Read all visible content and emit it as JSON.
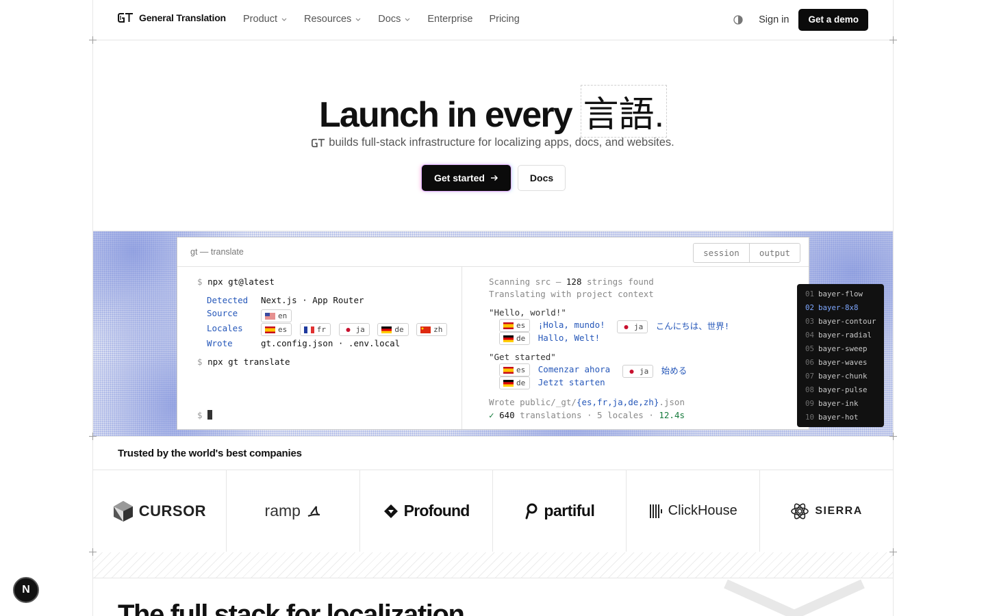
{
  "nav": {
    "brand": "General Translation",
    "links": [
      {
        "label": "Product"
      },
      {
        "label": "Resources"
      },
      {
        "label": "Docs"
      },
      {
        "label": "Enterprise"
      },
      {
        "label": "Pricing"
      }
    ],
    "sign_in": "Sign in",
    "demo": "Get a demo"
  },
  "hero": {
    "title_prefix": "Launch in every",
    "title_word": "言語",
    "title_suffix": ".",
    "subtitle": "builds full-stack infrastructure for localizing apps, docs, and websites.",
    "primary_cta": "Get started",
    "secondary_cta": "Docs"
  },
  "terminal": {
    "title": "gt — translate",
    "tabs": [
      "session",
      "output"
    ],
    "left": {
      "cmd1": "npx gt@latest",
      "detected_label": "Detected",
      "detected_value": "Next.js · App Router",
      "source_label": "Source",
      "source_locale": "en",
      "locales_label": "Locales",
      "locales": [
        "es",
        "fr",
        "ja",
        "de",
        "zh"
      ],
      "wrote_label": "Wrote",
      "wrote_value": "gt.config.json · .env.local",
      "cmd2": "npx gt translate",
      "prompt": "$"
    },
    "right": {
      "scan_prefix": "Scanning src —",
      "scan_count": "128",
      "scan_suffix": "strings found",
      "context": "Translating with project context",
      "block1_source": "\"Hello, world!\"",
      "block1": {
        "es": "¡Hola, mundo!",
        "ja": "こんにちは、世界!",
        "de": "Hallo, Welt!"
      },
      "block2_source": "\"Get started\"",
      "block2": {
        "es": "Comenzar ahora",
        "ja": "始める",
        "de": "Jetzt starten"
      },
      "wrote_prefix": "Wrote public/_gt/",
      "wrote_glob": "{es,fr,ja,de,zh}",
      "wrote_ext": ".json",
      "check": "✓",
      "translations_count": "640",
      "translations_label": "translations · 5 locales ·",
      "time": "12.4s"
    }
  },
  "presets": [
    {
      "num": "01",
      "name": "bayer-flow"
    },
    {
      "num": "02",
      "name": "bayer-8x8",
      "active": true
    },
    {
      "num": "03",
      "name": "bayer-contour"
    },
    {
      "num": "04",
      "name": "bayer-radial"
    },
    {
      "num": "05",
      "name": "bayer-sweep"
    },
    {
      "num": "06",
      "name": "bayer-waves"
    },
    {
      "num": "07",
      "name": "bayer-chunk"
    },
    {
      "num": "08",
      "name": "bayer-pulse"
    },
    {
      "num": "09",
      "name": "bayer-ink"
    },
    {
      "num": "10",
      "name": "bayer-hot"
    }
  ],
  "trusted": {
    "heading": "Trusted by the world's best companies",
    "companies": [
      "CURSOR",
      "ramp",
      "Profound",
      "partiful",
      "ClickHouse",
      "SIERRA"
    ]
  },
  "section2": {
    "title": "The full stack for localization"
  },
  "dev_badge": "N",
  "colors": {
    "accent_blue": "#2557b9",
    "active_preset": "#7ea7ff",
    "green": "#157a3b"
  }
}
